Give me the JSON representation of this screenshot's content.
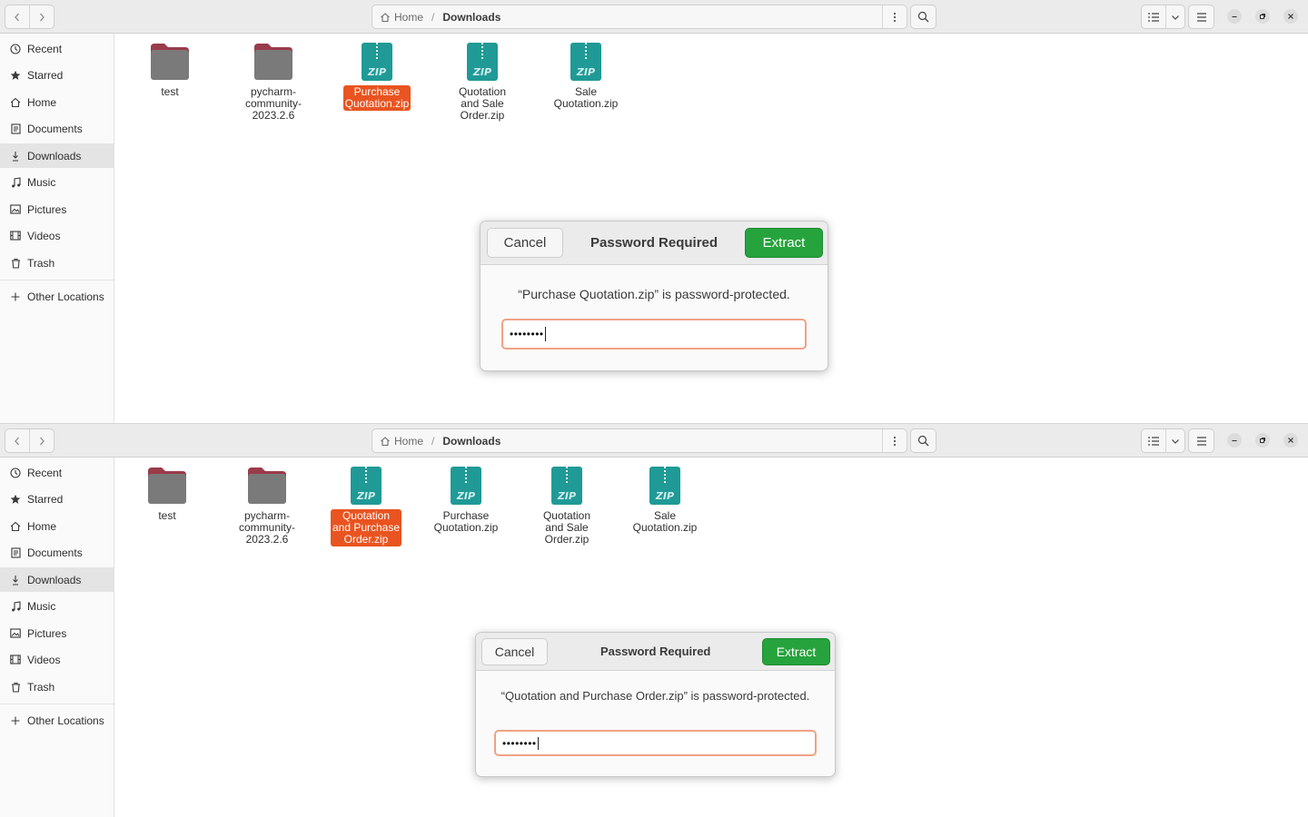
{
  "windows": [
    {
      "breadcrumb": {
        "home": "Home",
        "current": "Downloads"
      },
      "sidebar": {
        "places": [
          "Recent",
          "Starred",
          "Home",
          "Documents",
          "Downloads",
          "Music",
          "Pictures",
          "Videos",
          "Trash"
        ],
        "other": "Other Locations",
        "active": "Downloads"
      },
      "files": [
        {
          "name": "test",
          "kind": "folder"
        },
        {
          "name": "pycharm-\ncommunity-\n2023.2.6",
          "kind": "folder"
        },
        {
          "name": "Purchase\nQuotation.zip",
          "kind": "zip",
          "selected": true
        },
        {
          "name": "Quotation\nand Sale\nOrder.zip",
          "kind": "zip"
        },
        {
          "name": "Sale\nQuotation.zip",
          "kind": "zip"
        }
      ],
      "dialog": {
        "cancel": "Cancel",
        "title": "Password Required",
        "extract": "Extract",
        "message": "“Purchase Quotation.zip” is password-protected.",
        "password_masked": "••••••••"
      }
    },
    {
      "breadcrumb": {
        "home": "Home",
        "current": "Downloads"
      },
      "sidebar": {
        "places": [
          "Recent",
          "Starred",
          "Home",
          "Documents",
          "Downloads",
          "Music",
          "Pictures",
          "Videos",
          "Trash"
        ],
        "other": "Other Locations",
        "active": "Downloads"
      },
      "files": [
        {
          "name": "test",
          "kind": "folder"
        },
        {
          "name": "pycharm-\ncommunity-\n2023.2.6",
          "kind": "folder"
        },
        {
          "name": "Quotation\nand Purchase\nOrder.zip",
          "kind": "zip",
          "selected": true
        },
        {
          "name": "Purchase\nQuotation.zip",
          "kind": "zip"
        },
        {
          "name": "Quotation\nand Sale\nOrder.zip",
          "kind": "zip"
        },
        {
          "name": "Sale\nQuotation.zip",
          "kind": "zip"
        }
      ],
      "dialog": {
        "cancel": "Cancel",
        "title": "Password Required",
        "extract": "Extract",
        "message": "“Quotation and Purchase Order.zip” is password-protected.",
        "password_masked": "••••••••"
      }
    }
  ],
  "icons": {
    "back": "chevron-left-icon",
    "forward": "chevron-right-icon",
    "home": "home-icon",
    "path_menu": "kebab-icon",
    "search": "search-icon",
    "view_list": "list-view-icon",
    "view_options": "chevron-down-icon",
    "main_menu": "hamburger-icon",
    "minimize": "minimize-icon",
    "maximize": "restore-icon",
    "close": "close-icon"
  },
  "colors": {
    "selection": "#e95420",
    "extract_button": "#26a33c",
    "zip_icon": "#1f9a96",
    "folder_tab": "#9a3b4a",
    "folder_body": "#7a7a7a",
    "password_focus": "#f0a285"
  }
}
